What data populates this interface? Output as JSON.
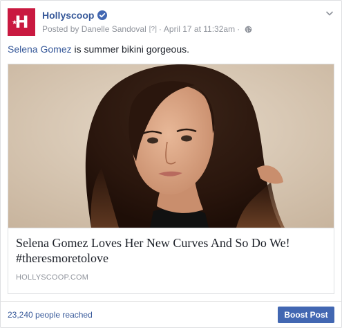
{
  "post": {
    "page_name": "Hollyscoop",
    "avatar_letter": "H",
    "avatar_star": "★",
    "posted_by": "Posted by Danelle Sandoval",
    "help_marker": "[?]",
    "separator": "·",
    "date": "April 17 at 11:32am",
    "privacy_icon": "globe-icon",
    "verified_icon": "verified-badge-icon",
    "menu_icon": "chevron-down-icon",
    "text_mention": "Selena Gomez",
    "text_rest": " is summer bikini gorgeous."
  },
  "link": {
    "title": "Selena Gomez Loves Her New Curves And So Do We! #theresmoretolove",
    "domain": "HOLLYSCOOP.COM"
  },
  "footer": {
    "reach_text": "23,240 people reached",
    "boost_label": "Boost Post"
  },
  "colors": {
    "brand": "#c91940",
    "link": "#365899",
    "button": "#4267b2",
    "meta": "#90949c"
  }
}
